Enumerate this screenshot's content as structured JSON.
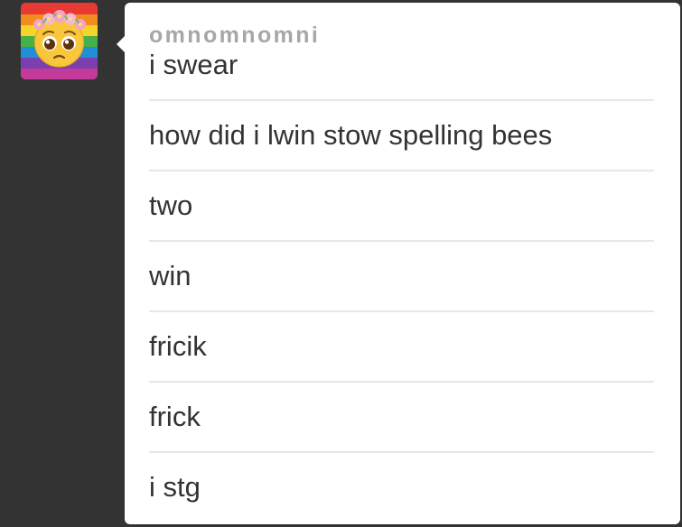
{
  "post": {
    "username": "omnomnomni",
    "avatar": {
      "icon": "pleading-face-flower-crown-icon",
      "stripes": [
        "#e83a35",
        "#f28c1e",
        "#f6d52a",
        "#46b04b",
        "#1f8fd6",
        "#7b3fb0",
        "#c43a9a"
      ]
    },
    "messages": [
      {
        "text": "i swear"
      },
      {
        "text": "how did i lwin stow spelling bees"
      },
      {
        "text": "two"
      },
      {
        "text": "win"
      },
      {
        "text": "fricik"
      },
      {
        "text": "frick"
      },
      {
        "text": "i stg"
      }
    ]
  },
  "colors": {
    "background": "#333333",
    "bubble": "#ffffff",
    "username": "#a7a7a7",
    "text": "#333333",
    "divider": "#e7e7e7"
  }
}
